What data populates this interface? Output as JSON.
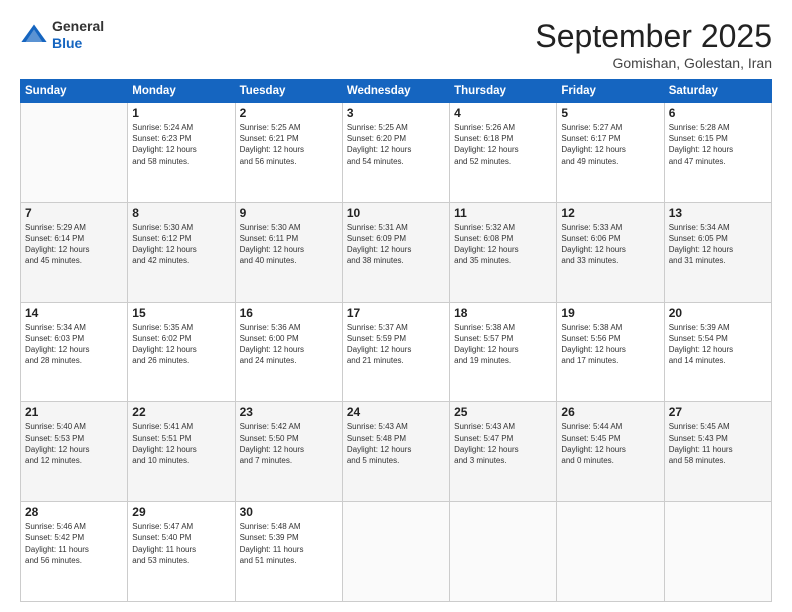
{
  "header": {
    "logo_general": "General",
    "logo_blue": "Blue",
    "month_title": "September 2025",
    "location": "Gomishan, Golestan, Iran"
  },
  "weekdays": [
    "Sunday",
    "Monday",
    "Tuesday",
    "Wednesday",
    "Thursday",
    "Friday",
    "Saturday"
  ],
  "weeks": [
    [
      {
        "day": "",
        "info": ""
      },
      {
        "day": "1",
        "info": "Sunrise: 5:24 AM\nSunset: 6:23 PM\nDaylight: 12 hours\nand 58 minutes."
      },
      {
        "day": "2",
        "info": "Sunrise: 5:25 AM\nSunset: 6:21 PM\nDaylight: 12 hours\nand 56 minutes."
      },
      {
        "day": "3",
        "info": "Sunrise: 5:25 AM\nSunset: 6:20 PM\nDaylight: 12 hours\nand 54 minutes."
      },
      {
        "day": "4",
        "info": "Sunrise: 5:26 AM\nSunset: 6:18 PM\nDaylight: 12 hours\nand 52 minutes."
      },
      {
        "day": "5",
        "info": "Sunrise: 5:27 AM\nSunset: 6:17 PM\nDaylight: 12 hours\nand 49 minutes."
      },
      {
        "day": "6",
        "info": "Sunrise: 5:28 AM\nSunset: 6:15 PM\nDaylight: 12 hours\nand 47 minutes."
      }
    ],
    [
      {
        "day": "7",
        "info": "Sunrise: 5:29 AM\nSunset: 6:14 PM\nDaylight: 12 hours\nand 45 minutes."
      },
      {
        "day": "8",
        "info": "Sunrise: 5:30 AM\nSunset: 6:12 PM\nDaylight: 12 hours\nand 42 minutes."
      },
      {
        "day": "9",
        "info": "Sunrise: 5:30 AM\nSunset: 6:11 PM\nDaylight: 12 hours\nand 40 minutes."
      },
      {
        "day": "10",
        "info": "Sunrise: 5:31 AM\nSunset: 6:09 PM\nDaylight: 12 hours\nand 38 minutes."
      },
      {
        "day": "11",
        "info": "Sunrise: 5:32 AM\nSunset: 6:08 PM\nDaylight: 12 hours\nand 35 minutes."
      },
      {
        "day": "12",
        "info": "Sunrise: 5:33 AM\nSunset: 6:06 PM\nDaylight: 12 hours\nand 33 minutes."
      },
      {
        "day": "13",
        "info": "Sunrise: 5:34 AM\nSunset: 6:05 PM\nDaylight: 12 hours\nand 31 minutes."
      }
    ],
    [
      {
        "day": "14",
        "info": "Sunrise: 5:34 AM\nSunset: 6:03 PM\nDaylight: 12 hours\nand 28 minutes."
      },
      {
        "day": "15",
        "info": "Sunrise: 5:35 AM\nSunset: 6:02 PM\nDaylight: 12 hours\nand 26 minutes."
      },
      {
        "day": "16",
        "info": "Sunrise: 5:36 AM\nSunset: 6:00 PM\nDaylight: 12 hours\nand 24 minutes."
      },
      {
        "day": "17",
        "info": "Sunrise: 5:37 AM\nSunset: 5:59 PM\nDaylight: 12 hours\nand 21 minutes."
      },
      {
        "day": "18",
        "info": "Sunrise: 5:38 AM\nSunset: 5:57 PM\nDaylight: 12 hours\nand 19 minutes."
      },
      {
        "day": "19",
        "info": "Sunrise: 5:38 AM\nSunset: 5:56 PM\nDaylight: 12 hours\nand 17 minutes."
      },
      {
        "day": "20",
        "info": "Sunrise: 5:39 AM\nSunset: 5:54 PM\nDaylight: 12 hours\nand 14 minutes."
      }
    ],
    [
      {
        "day": "21",
        "info": "Sunrise: 5:40 AM\nSunset: 5:53 PM\nDaylight: 12 hours\nand 12 minutes."
      },
      {
        "day": "22",
        "info": "Sunrise: 5:41 AM\nSunset: 5:51 PM\nDaylight: 12 hours\nand 10 minutes."
      },
      {
        "day": "23",
        "info": "Sunrise: 5:42 AM\nSunset: 5:50 PM\nDaylight: 12 hours\nand 7 minutes."
      },
      {
        "day": "24",
        "info": "Sunrise: 5:43 AM\nSunset: 5:48 PM\nDaylight: 12 hours\nand 5 minutes."
      },
      {
        "day": "25",
        "info": "Sunrise: 5:43 AM\nSunset: 5:47 PM\nDaylight: 12 hours\nand 3 minutes."
      },
      {
        "day": "26",
        "info": "Sunrise: 5:44 AM\nSunset: 5:45 PM\nDaylight: 12 hours\nand 0 minutes."
      },
      {
        "day": "27",
        "info": "Sunrise: 5:45 AM\nSunset: 5:43 PM\nDaylight: 11 hours\nand 58 minutes."
      }
    ],
    [
      {
        "day": "28",
        "info": "Sunrise: 5:46 AM\nSunset: 5:42 PM\nDaylight: 11 hours\nand 56 minutes."
      },
      {
        "day": "29",
        "info": "Sunrise: 5:47 AM\nSunset: 5:40 PM\nDaylight: 11 hours\nand 53 minutes."
      },
      {
        "day": "30",
        "info": "Sunrise: 5:48 AM\nSunset: 5:39 PM\nDaylight: 11 hours\nand 51 minutes."
      },
      {
        "day": "",
        "info": ""
      },
      {
        "day": "",
        "info": ""
      },
      {
        "day": "",
        "info": ""
      },
      {
        "day": "",
        "info": ""
      }
    ]
  ]
}
